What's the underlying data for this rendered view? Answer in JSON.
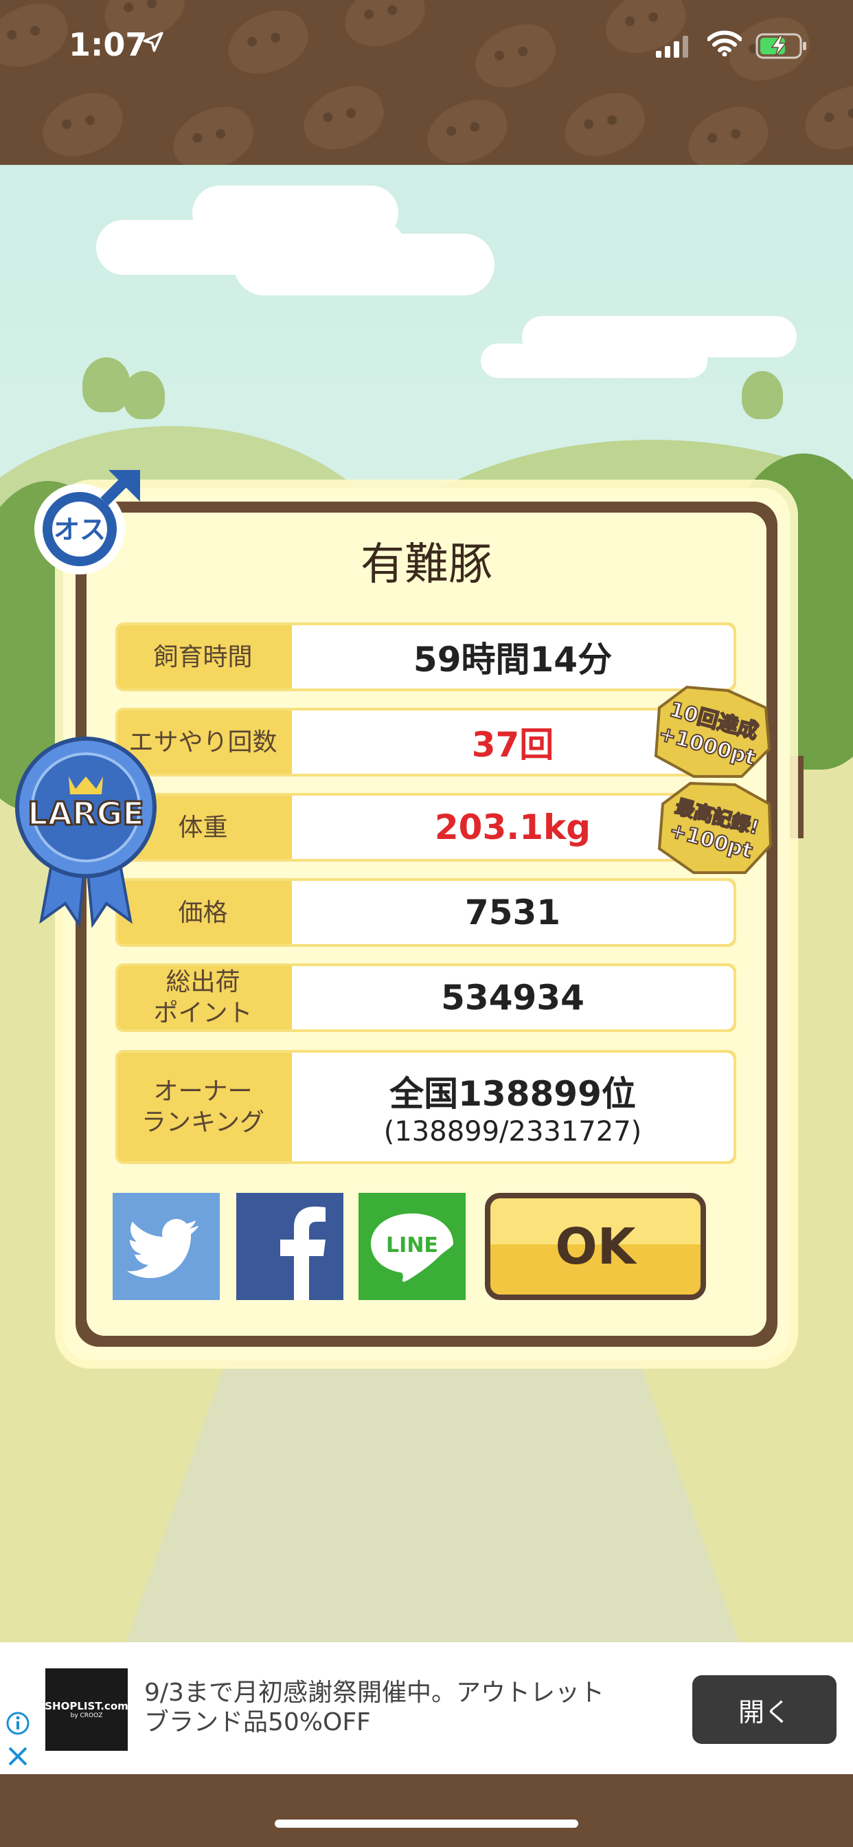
{
  "status_bar": {
    "time": "1:07"
  },
  "card": {
    "title": "有難豚",
    "rows": [
      {
        "label": "飼育時間",
        "value": "59時間14分",
        "highlight": false
      },
      {
        "label": "エサやり回数",
        "value": "37回",
        "highlight": true
      },
      {
        "label": "体重",
        "value": "203.1kg",
        "highlight": true
      },
      {
        "label": "価格",
        "value": "7531",
        "highlight": false
      },
      {
        "label": "総出荷\nポイント",
        "value": "534934",
        "highlight": false
      },
      {
        "label": "オーナー\nランキング",
        "value": "全国138899位",
        "sub": "(138899/2331727)",
        "highlight": false
      }
    ],
    "badges": {
      "gender": "オス",
      "size": "LARGE",
      "bonus1_line1": "10回達成",
      "bonus1_line2": "+1000pt",
      "bonus2_line1": "最高記録!",
      "bonus2_line2": "+100pt"
    },
    "buttons": {
      "ok": "OK",
      "line": "LINE"
    }
  },
  "ad": {
    "logo": "SHOPLIST.com",
    "logo_sub": "by CROOZ",
    "text_line1": "9/3まで月初感謝祭開催中。アウトレット",
    "text_line2": "ブランド品50%OFF",
    "open_button": "開く"
  },
  "colors": {
    "brown": "#6b4c34",
    "accent_yellow": "#f5d65e",
    "highlight_red": "#e0282c",
    "twitter": "#6ea2dd",
    "facebook": "#3b5998",
    "line": "#3aae36"
  }
}
